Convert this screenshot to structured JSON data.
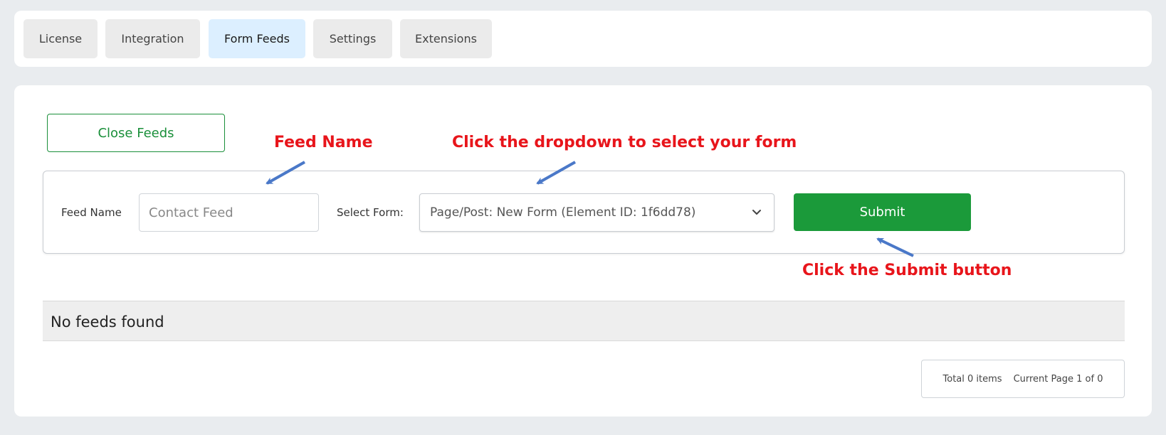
{
  "tabs": [
    {
      "label": "License",
      "active": false
    },
    {
      "label": "Integration",
      "active": false
    },
    {
      "label": "Form Feeds",
      "active": true
    },
    {
      "label": "Settings",
      "active": false
    },
    {
      "label": "Extensions",
      "active": false
    }
  ],
  "close_feeds_label": "Close Feeds",
  "form": {
    "feed_name_label": "Feed Name",
    "feed_name_placeholder": "Contact Feed",
    "feed_name_value": "",
    "select_form_label": "Select Form:",
    "select_form_value": "Page/Post: New Form (Element ID: 1f6dd78)",
    "submit_label": "Submit"
  },
  "empty_state": "No feeds found",
  "pagination": {
    "total": "Total 0 items",
    "current_page": "Current Page 1 of 0"
  },
  "annotations": {
    "feed_name": "Feed Name",
    "dropdown": "Click the dropdown to select your form",
    "submit": "Click the Submit button"
  },
  "colors": {
    "accent_green": "#1b9a3a",
    "annotation_red": "#e8151b",
    "arrow_blue": "#4a78c8",
    "active_tab": "#dcefff"
  },
  "icons": {
    "dropdown": "chevron-down-icon",
    "annotation_arrow": "arrow-icon"
  }
}
